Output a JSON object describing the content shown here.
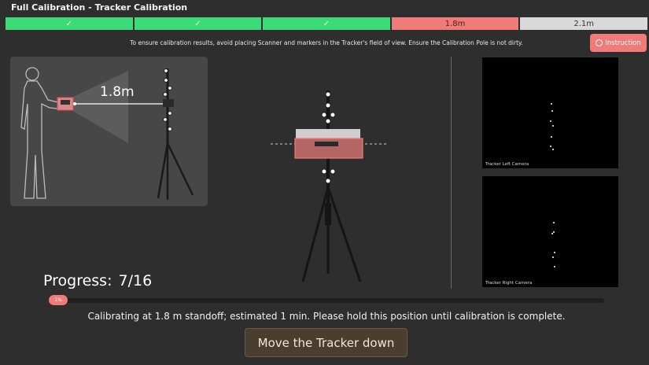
{
  "header": {
    "title": "Full Calibration - Tracker Calibration"
  },
  "steps": [
    {
      "state": "done",
      "label": "✓"
    },
    {
      "state": "done",
      "label": "✓"
    },
    {
      "state": "done",
      "label": "✓"
    },
    {
      "state": "active",
      "label": "1.8m"
    },
    {
      "state": "todo",
      "label": "2.1m"
    }
  ],
  "hint": "To ensure calibration results, avoid placing Scanner and markers in the Tracker's field of view. Ensure the Calibration Pole is not dirty.",
  "instruction_button": {
    "label": "Instruction",
    "icon": "smile-icon"
  },
  "illustration": {
    "distance": "1.8m"
  },
  "cameras": {
    "left_label": "Tracker Left Camera",
    "right_label": "Tracker Right Camera"
  },
  "progress": {
    "label": "Progress:",
    "value": "7/16",
    "percent_text": "1%",
    "percent": 1
  },
  "status": "Calibrating at 1.8 m standoff; estimated 1 min. Please hold this position until calibration is complete.",
  "action_button": {
    "label": "Move the Tracker down"
  },
  "colors": {
    "done": "#3ddb78",
    "active": "#f07b78",
    "todo": "#d9d9d9",
    "accent": "#f07b78"
  }
}
